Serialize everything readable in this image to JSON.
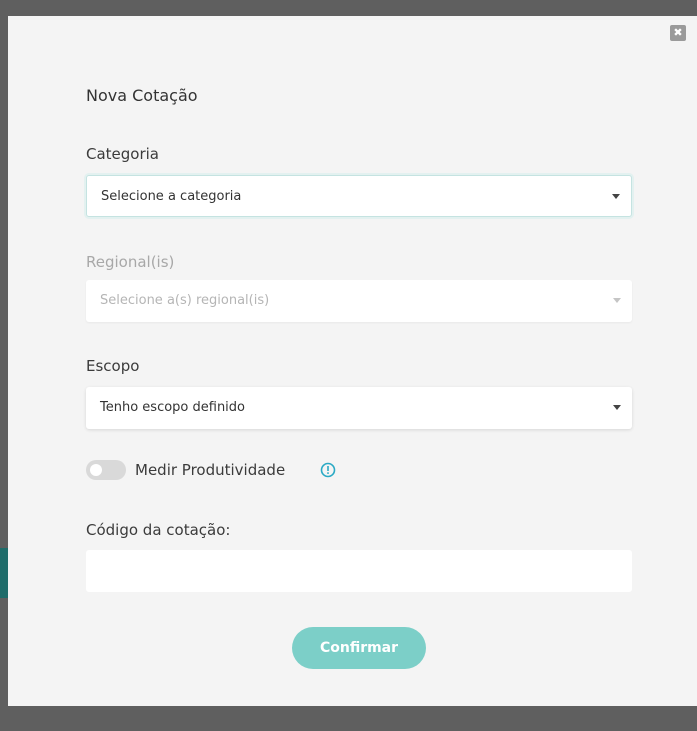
{
  "modal": {
    "close_symbol": "✖",
    "title": "Nova Cotação"
  },
  "categoria": {
    "label": "Categoria",
    "value": "Selecione a categoria"
  },
  "regional": {
    "label": "Regional(is)",
    "value": "Selecione a(s) regional(is)"
  },
  "escopo": {
    "label": "Escopo",
    "value": "Tenho escopo definido"
  },
  "produtividade": {
    "label": "Medir Produtividade",
    "enabled": false,
    "info_icon": "info-circle-icon"
  },
  "codigo": {
    "label": "Código da cotação:",
    "value": ""
  },
  "confirm_label": "Confirmar",
  "colors": {
    "accent": "#7ccfc8",
    "info": "#2aa9c4"
  }
}
